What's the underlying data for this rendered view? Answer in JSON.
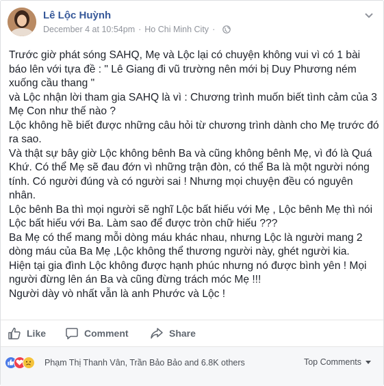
{
  "post": {
    "author": "Lê Lộc Huỳnh",
    "date": "December 4 at 10:54pm",
    "separator": "·",
    "location": "Ho Chi Minh City",
    "separator2": "·",
    "privacy_icon": "globe-icon",
    "menu_icon": "chevron-down-icon",
    "body_lines": [
      "Trước giờ phát sóng SAHQ, Mẹ và Lộc lại có chuyện không vui vì có 1 bài",
      "báo lên với tựa đề : \" Lê Giang đi vũ trường nên mới bị Duy Phương ném",
      "xuống cầu thang \"",
      "và Lộc nhận lời tham gia SAHQ là vì : Chương trình muốn biết tình cảm của 3",
      "Mẹ Con như thế nào ?",
      "Lộc không hề biết được những câu hỏi từ chương trình dành cho Mẹ trước đó",
      "ra sao.",
      "Và thật sự bây giờ Lộc không bênh Ba và cũng không bênh Mẹ, vì đó là Quá",
      "Khứ. Có thể Mẹ sẽ đau đớn vì những trận đòn, có thể Ba là một người nóng",
      "tính. Có người đúng và có người sai ! Nhưng mọi chuyện đều có nguyên",
      "nhân.",
      "Lộc bênh Ba thì mọi người sẽ nghĩ Lộc bất hiếu với Mẹ , Lộc bênh Mẹ thì nói",
      "Lộc bất hiếu với Ba. Làm sao để được tròn chữ hiếu ???",
      "Ba Mẹ có thể mang mỗi dòng máu khác nhau, nhưng Lộc là người mang 2",
      "dòng máu của Ba Mẹ ,Lộc không thể thương người này, ghét người kia.",
      "Hiện tại gia đình Lộc không được hạnh phúc nhưng nó được bình yên ! Mọi",
      "người đừng lên án Ba và cũng đừng trách móc Mẹ !!!",
      "Người dày vò nhất vẫn là anh Phước và Lộc !"
    ]
  },
  "actions": {
    "like_label": "Like",
    "comment_label": "Comment",
    "share_label": "Share"
  },
  "reactions": {
    "icons": [
      "like-reaction-icon",
      "love-reaction-icon",
      "sad-reaction-icon"
    ],
    "names_text": "Phạm Thị Thanh Vân, Trần Bảo Bảo and 6.8K others",
    "sort_label": "Top Comments"
  },
  "colors": {
    "author_link": "#365899",
    "meta_gray": "#90949c",
    "like_blue": "#4a7ae7",
    "love_red": "#f0404e",
    "sad_yellow": "#f5c33b"
  }
}
